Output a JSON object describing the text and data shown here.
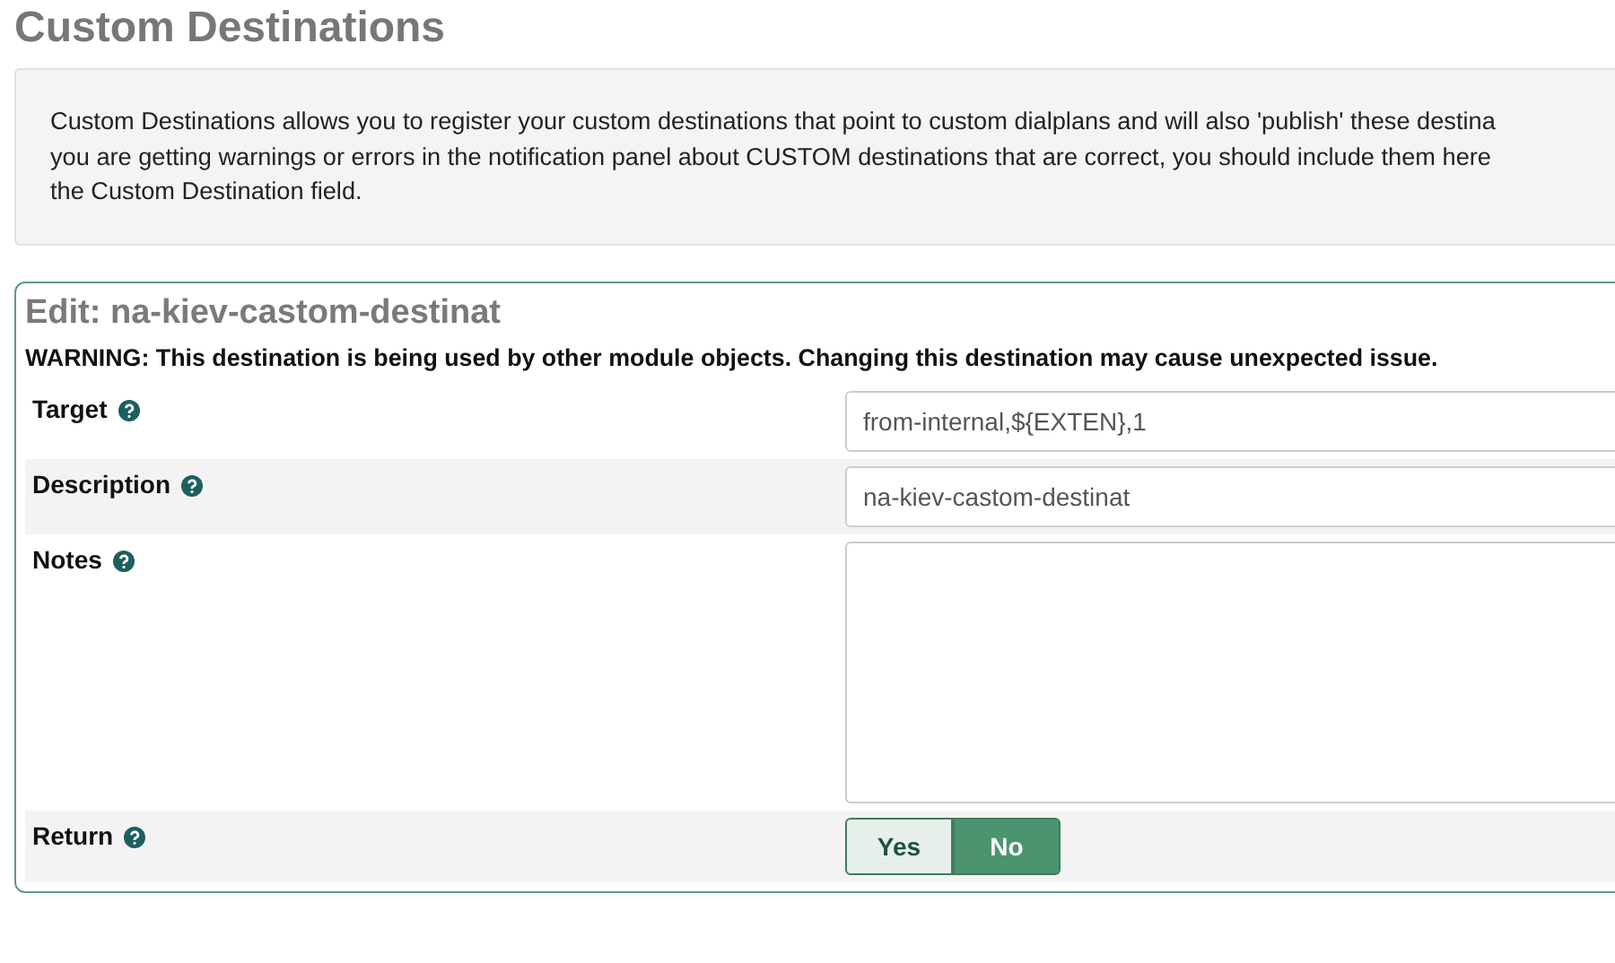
{
  "page_title": "Custom Destinations",
  "info_lines": [
    "Custom Destinations allows you to register your custom destinations that point to custom dialplans and will also 'publish' these destina",
    "you are getting warnings or errors in the notification panel about CUSTOM destinations that are correct, you should include them here",
    "the Custom Destination field."
  ],
  "edit_panel": {
    "title": "Edit: na-kiev-castom-destinat",
    "warning": "WARNING: This destination is being used by other module objects. Changing this destination may cause unexpected issue.",
    "fields": [
      {
        "kind": "text",
        "label": "Target",
        "value": "from-internal,${EXTEN},1"
      },
      {
        "kind": "text",
        "label": "Description",
        "value": "na-kiev-castom-destinat"
      },
      {
        "kind": "textarea",
        "label": "Notes"
      },
      {
        "kind": "toggle",
        "label": "Return",
        "options": [
          {
            "label": "Yes",
            "selected": false
          },
          {
            "label": "No",
            "selected": true
          }
        ]
      }
    ]
  }
}
